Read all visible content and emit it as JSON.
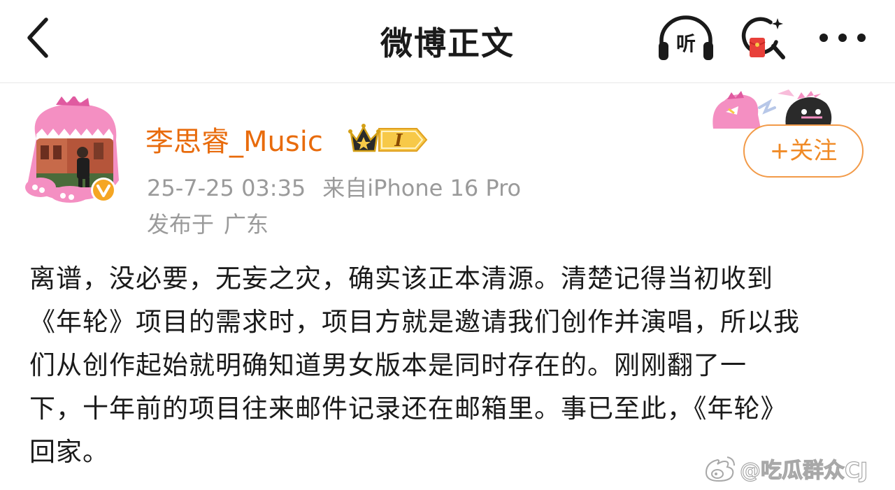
{
  "nav": {
    "title": "微博正文",
    "back_icon": "chevron-left-icon",
    "listen_label": "听",
    "listen_icon": "headphones-icon",
    "search_icon": "search-redpacket-icon",
    "more_icon": "more-dots-icon"
  },
  "author": {
    "name": "李思睿_Music",
    "verified_icon": "verified-v-icon",
    "badge_icon": "crown-membership-badge",
    "badge_level": "I",
    "date": "25-7-25 03:35",
    "source": "来自iPhone 16 Pro",
    "location_label": "发布于",
    "location": "广东",
    "follow_label": "+关注"
  },
  "post": {
    "lines": [
      "离谱，没必要，无妄之灾，确实该正本清源。清楚记得当初收到",
      "《年轮》项目的需求时，项目方就是邀请我们创作并演唱，所以我",
      "们从创作起始就明确知道男女版本是同时存在的。刚刚翻了一",
      "下，十年前的项目往来邮件记录还在邮箱里。事已至此，《年轮》",
      "回家。"
    ]
  },
  "watermark": {
    "text": "@吃瓜群众CJ",
    "icon": "weibo-logo-icon"
  },
  "colors": {
    "accent": "#e86b0c",
    "follow_border": "#f29a48",
    "meta_text": "#9a9a9a",
    "verified_bg": "#f5a623",
    "red_packet": "#e8403a"
  }
}
